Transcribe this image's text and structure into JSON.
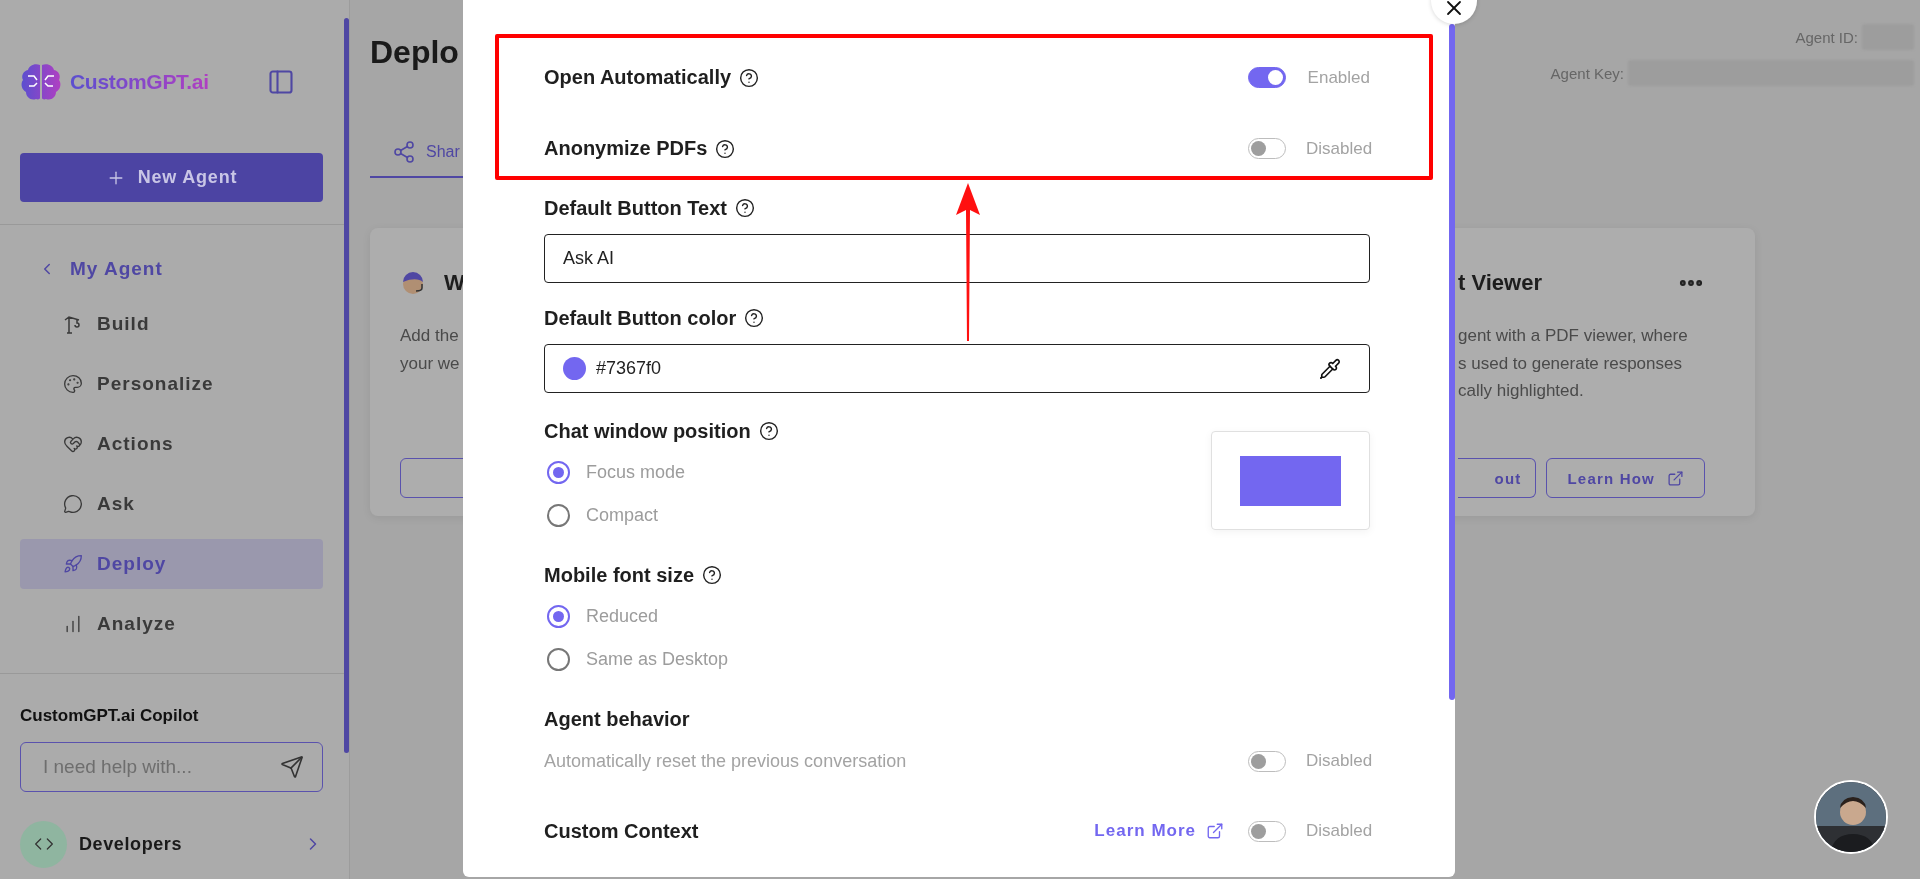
{
  "sidebar": {
    "logo": "CustomGPT.ai",
    "new_agent_button": "New Agent",
    "back_label": "My Agent",
    "items": [
      {
        "label": "Build",
        "selected": false
      },
      {
        "label": "Personalize",
        "selected": false
      },
      {
        "label": "Actions",
        "selected": false
      },
      {
        "label": "Ask",
        "selected": false
      },
      {
        "label": "Deploy",
        "selected": true
      },
      {
        "label": "Analyze",
        "selected": false
      }
    ],
    "copilot": {
      "title": "CustomGPT.ai Copilot",
      "placeholder": "I need help with..."
    },
    "developers": "Developers"
  },
  "header": {
    "title": "Deplo",
    "agent_id_label": "Agent ID:",
    "agent_key_label": "Agent Key:"
  },
  "tabs": [
    {
      "label": "Shar",
      "selected": true
    }
  ],
  "cards": [
    {
      "title": "W",
      "lines": [
        "Add the",
        "your we"
      ]
    },
    {
      "title": "t Viewer",
      "lines": [
        "gent with a PDF viewer, where",
        "s used to generate responses",
        "cally highlighted."
      ],
      "buttons": [
        {
          "label": "out"
        },
        {
          "label": "Learn How",
          "external": true
        }
      ]
    }
  ],
  "modal": {
    "settings": [
      {
        "kind": "toggle",
        "label": "Open Automatically",
        "help": true,
        "on": true,
        "status": "Enabled"
      },
      {
        "kind": "toggle",
        "label": "Anonymize PDFs",
        "help": true,
        "on": false,
        "status": "Disabled"
      },
      {
        "kind": "text",
        "label": "Default Button Text",
        "help": true,
        "value": "Ask AI"
      },
      {
        "kind": "color",
        "label": "Default Button color",
        "help": true,
        "value": "#7367f0",
        "color": "#7367f0"
      },
      {
        "kind": "radio",
        "label": "Chat window position",
        "help": true,
        "preview": true,
        "options": [
          {
            "label": "Focus mode",
            "selected": true
          },
          {
            "label": "Compact",
            "selected": false
          }
        ]
      },
      {
        "kind": "radio",
        "label": "Mobile font size",
        "help": true,
        "options": [
          {
            "label": "Reduced",
            "selected": true
          },
          {
            "label": "Same as Desktop",
            "selected": false
          }
        ]
      },
      {
        "kind": "described_toggle",
        "label": "Agent behavior",
        "description": "Automatically reset the previous conversation",
        "on": false,
        "status": "Disabled"
      },
      {
        "kind": "toggle",
        "label": "Custom Context",
        "link": "Learn More",
        "on": false,
        "status": "Disabled"
      }
    ]
  },
  "annotations": {
    "highlight_frame": true,
    "arrow": true
  }
}
